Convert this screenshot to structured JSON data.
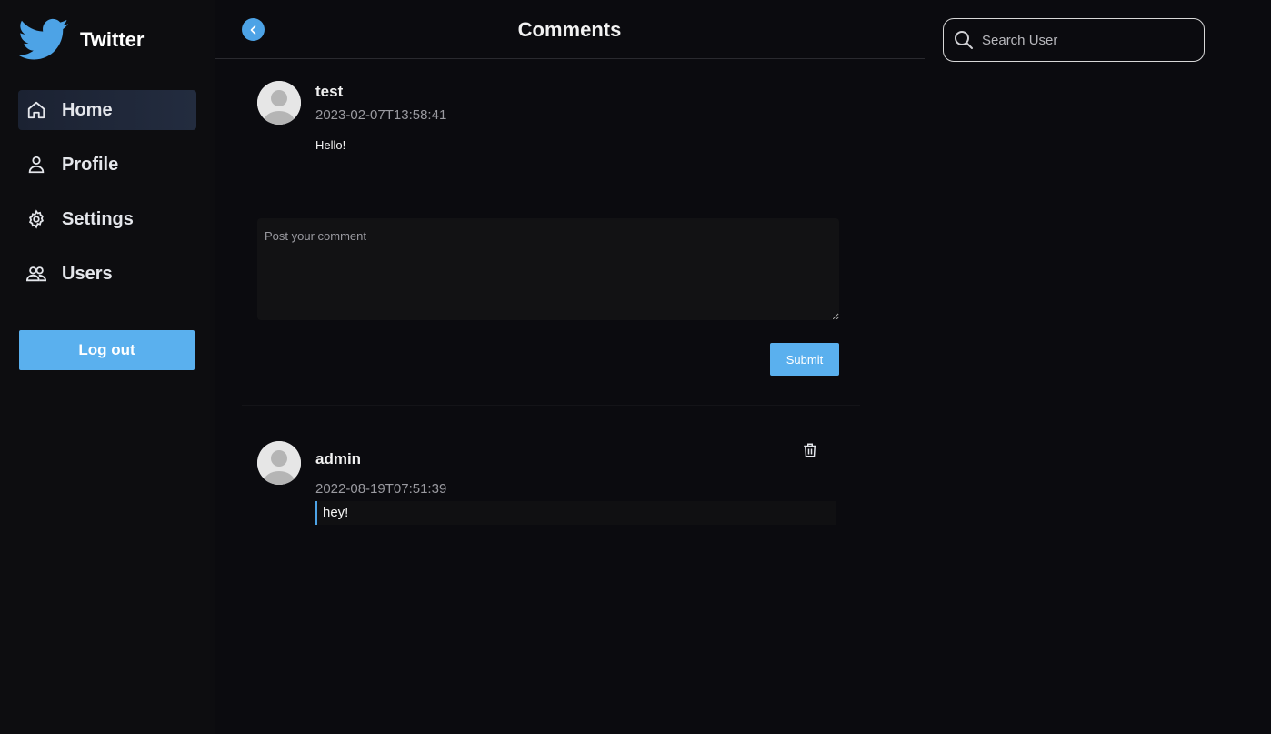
{
  "brand": {
    "name": "Twitter",
    "color": "#4da3e6"
  },
  "sidebar": {
    "items": [
      {
        "label": "Home",
        "icon": "home-icon",
        "active": true
      },
      {
        "label": "Profile",
        "icon": "user-icon",
        "active": false
      },
      {
        "label": "Settings",
        "icon": "gear-icon",
        "active": false
      },
      {
        "label": "Users",
        "icon": "users-icon",
        "active": false
      }
    ],
    "logout_label": "Log out"
  },
  "header": {
    "title": "Comments"
  },
  "post": {
    "username": "test",
    "timestamp": "2023-02-07T13:58:41",
    "text": "Hello!"
  },
  "compose": {
    "placeholder": "Post your comment",
    "submit_label": "Submit"
  },
  "comments": [
    {
      "username": "admin",
      "timestamp": "2022-08-19T07:51:39",
      "text": "hey!"
    }
  ],
  "search": {
    "placeholder": "Search User"
  },
  "colors": {
    "accent": "#5ab0ee",
    "background": "#0b0b0f",
    "sidebar": "#0d0d10"
  }
}
